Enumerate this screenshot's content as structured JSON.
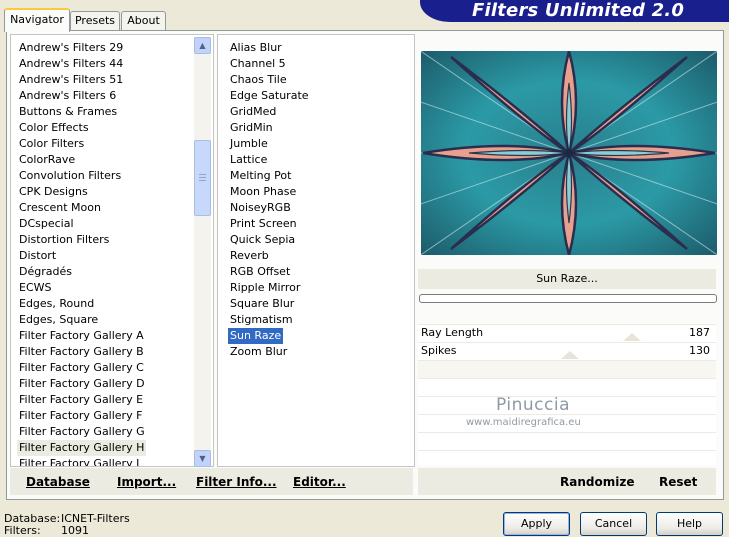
{
  "banner": {
    "title": "Filters Unlimited 2.0"
  },
  "tabs": [
    {
      "label": "Navigator",
      "active": true
    },
    {
      "label": "Presets",
      "active": false
    },
    {
      "label": "About",
      "active": false
    }
  ],
  "categories": {
    "items": [
      "Andrew's Filters 29",
      "Andrew's Filters 44",
      "Andrew's Filters 51",
      "Andrew's Filters 6",
      "Buttons & Frames",
      "Color Effects",
      "Color Filters",
      "ColorRave",
      "Convolution Filters",
      "CPK Designs",
      "Crescent Moon",
      "DCspecial",
      "Distortion Filters",
      "Distort",
      "Dégradés",
      "ECWS",
      "Edges, Round",
      "Edges, Square",
      "Filter Factory Gallery A",
      "Filter Factory Gallery B",
      "Filter Factory Gallery C",
      "Filter Factory Gallery D",
      "Filter Factory Gallery E",
      "Filter Factory Gallery F",
      "Filter Factory Gallery G",
      "Filter Factory Gallery H",
      "Filter Factory Gallery J"
    ],
    "selected": "Filter Factory Gallery H"
  },
  "filters": {
    "items": [
      "Alias Blur",
      "Channel 5",
      "Chaos Tile",
      "Edge Saturate",
      "GridMed",
      "GridMin",
      "Jumble",
      "Lattice",
      "Melting Pot",
      "Moon Phase",
      "NoiseyRGB",
      "Print Screen",
      "Quick Sepia",
      "Reverb",
      "RGB Offset",
      "Ripple Mirror",
      "Square Blur",
      "Stigmatism",
      "Sun Raze",
      "Zoom Blur"
    ],
    "selected": "Sun Raze"
  },
  "preview": {
    "filter_name": "Sun Raze..."
  },
  "params": [
    {
      "label": "Ray Length",
      "value": "187",
      "level": 0.733
    },
    {
      "label": "Spikes",
      "value": "130",
      "level": 0.51
    }
  ],
  "watermark": {
    "name": "Pinuccia",
    "url": "www.maidiregrafica.eu"
  },
  "bottom_buttons": {
    "database": "Database",
    "import": "Import...",
    "filter_info": "Filter Info...",
    "editor": "Editor...",
    "randomize": "Randomize",
    "reset": "Reset"
  },
  "footer": {
    "database_label": "Database:",
    "database_value": "ICNET-Filters",
    "filters_label": "Filters:",
    "filters_value": "1091"
  },
  "dialog_buttons": {
    "apply": "Apply",
    "cancel": "Cancel",
    "help": "Help"
  },
  "colors": {
    "banner": "#1a1f8e",
    "selection": "#316ac5",
    "tab_highlight": "#ffc83c"
  }
}
